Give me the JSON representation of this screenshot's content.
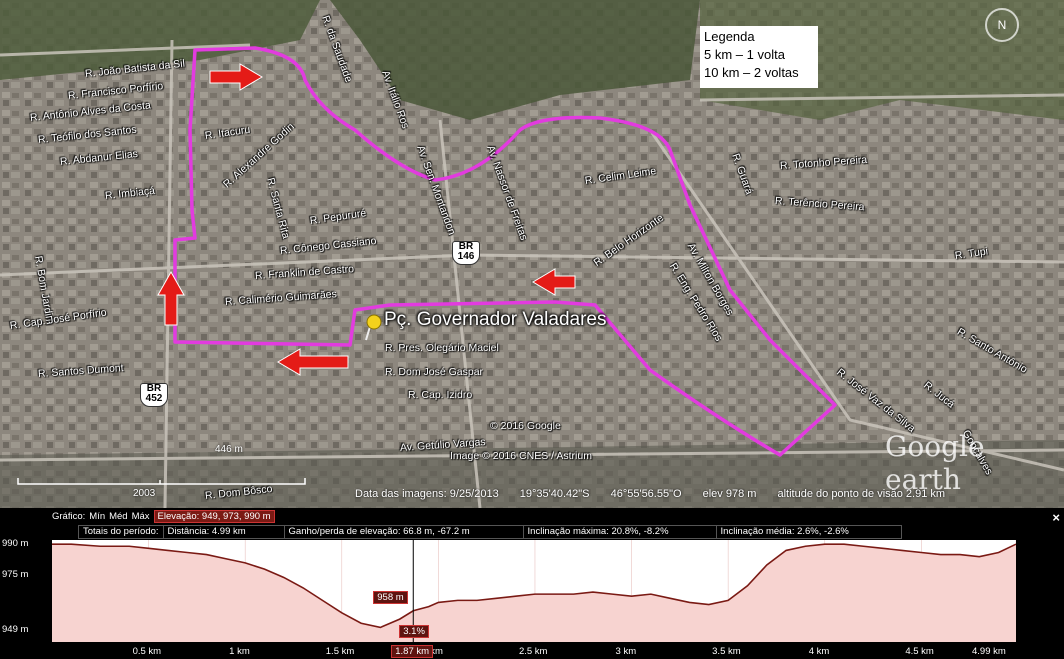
{
  "legend": {
    "title": "Legenda",
    "line1": "5 km – 1 volta",
    "line2": "10 km – 2 voltas"
  },
  "plaza": "Pç. Governador Valadares",
  "streets": [
    {
      "t": "R. João Batista da Sil",
      "x": 85,
      "y": 68,
      "r": -6
    },
    {
      "t": "R. Francisco Porfírio",
      "x": 68,
      "y": 90,
      "r": -6
    },
    {
      "t": "R. Antônio Alves da Costa",
      "x": 30,
      "y": 112,
      "r": -6
    },
    {
      "t": "R. Teófilo dos Santos",
      "x": 38,
      "y": 134,
      "r": -6
    },
    {
      "t": "R. Abdanur Elias",
      "x": 60,
      "y": 156,
      "r": -6
    },
    {
      "t": "R. Imbiaçá",
      "x": 105,
      "y": 190,
      "r": -6
    },
    {
      "t": "R. Bom Jardim",
      "x": 38,
      "y": 250,
      "r": 80
    },
    {
      "t": "R. Itacuru",
      "x": 205,
      "y": 130,
      "r": -8
    },
    {
      "t": "R. Alexandre Godin",
      "x": 225,
      "y": 180,
      "r": -42
    },
    {
      "t": "R. Santa Rita",
      "x": 270,
      "y": 172,
      "r": 75
    },
    {
      "t": "R. da Saudade",
      "x": 325,
      "y": 10,
      "r": 70
    },
    {
      "t": "Av. Itálio Ros",
      "x": 385,
      "y": 65,
      "r": 70
    },
    {
      "t": "Av. Sen. Montandon",
      "x": 420,
      "y": 140,
      "r": 70
    },
    {
      "t": "Av. Nassor de Freitas",
      "x": 490,
      "y": 140,
      "r": 70
    },
    {
      "t": "R. Pepururé",
      "x": 310,
      "y": 215,
      "r": -8
    },
    {
      "t": "R. Cônego Cassiano",
      "x": 280,
      "y": 245,
      "r": -6
    },
    {
      "t": "R. Franklin de Castro",
      "x": 255,
      "y": 270,
      "r": -4
    },
    {
      "t": "R. Calimério Guimarães",
      "x": 225,
      "y": 296,
      "r": -4
    },
    {
      "t": "R. Cap. José Porfírio",
      "x": 10,
      "y": 320,
      "r": -8
    },
    {
      "t": "R. Santos Dumont",
      "x": 38,
      "y": 368,
      "r": -4
    },
    {
      "t": "R. Pres. Olegário Maciel",
      "x": 385,
      "y": 342,
      "r": 0
    },
    {
      "t": "R. Dom José Gaspar",
      "x": 385,
      "y": 366,
      "r": 0
    },
    {
      "t": "R. Cap. Izidro",
      "x": 408,
      "y": 389,
      "r": 0
    },
    {
      "t": "Av. Getúlio Vargas",
      "x": 400,
      "y": 442,
      "r": -4
    },
    {
      "t": "R. Dom Bôsco",
      "x": 205,
      "y": 490,
      "r": -6
    },
    {
      "t": "R. Celim Leime",
      "x": 585,
      "y": 175,
      "r": -8
    },
    {
      "t": "R. Belo Horizonte",
      "x": 595,
      "y": 258,
      "r": -35
    },
    {
      "t": "Av. Milton Borges",
      "x": 690,
      "y": 238,
      "r": 60
    },
    {
      "t": "R. Eng. Pedro Rios",
      "x": 672,
      "y": 258,
      "r": 58
    },
    {
      "t": "R. Guará",
      "x": 735,
      "y": 148,
      "r": 70
    },
    {
      "t": "R. Totonho Pereira",
      "x": 780,
      "y": 160,
      "r": -4
    },
    {
      "t": "R. Terêncio Pereira",
      "x": 775,
      "y": 195,
      "r": 4
    },
    {
      "t": "R. Tupi",
      "x": 955,
      "y": 250,
      "r": -8
    },
    {
      "t": "R. Santo Antônio",
      "x": 958,
      "y": 325,
      "r": 30
    },
    {
      "t": "R. José Vaz da Silva",
      "x": 838,
      "y": 365,
      "r": 38
    },
    {
      "t": "R. Jucá",
      "x": 925,
      "y": 378,
      "r": 38
    },
    {
      "t": "Gonçalves",
      "x": 965,
      "y": 425,
      "r": 60
    }
  ],
  "shields": [
    {
      "top": "BR",
      "num": "146"
    },
    {
      "top": "BR",
      "num": "452"
    }
  ],
  "copyright1": "© 2016 Google",
  "copyright2": "Image © 2016 CNES / Astrium",
  "scale_label": "446 m",
  "year": "2003",
  "branding": "Google earth",
  "compass": "N",
  "status": {
    "date": "Data das imagens: 9/25/2013",
    "lat": "19°35'40.42\"S",
    "lon": "46°55'56.55\"O",
    "elev": "elev  978 m",
    "alt": "altitude do ponto de visão  2.91 km"
  },
  "panel": {
    "graph_label": "Gráfico:",
    "min": "Mín",
    "med": "Méd",
    "max": "Máx",
    "elevation": "Elevação: 949, 973, 990 m",
    "totals": "Totais do período:",
    "distance": "Distância: 4.99 km",
    "gain": "Ganho/perda de elevação: 66.8 m, -67.2 m",
    "max_slope": "Inclinação máxima: 20.8%, -8.2%",
    "avg_slope": "Inclinação média: 2.6%, -2.6%",
    "close": "×",
    "cursor_elev": "958 m",
    "cursor_slope": "3.1%",
    "cursor_dist": "1.87 km"
  },
  "chart_data": {
    "type": "area",
    "title": "",
    "xlabel": "",
    "ylabel": "",
    "xlim": [
      0,
      4.99
    ],
    "ylim": [
      943,
      992
    ],
    "y_ticks": [
      "990 m",
      "975 m",
      "949 m"
    ],
    "y_tick_values": [
      990,
      975,
      949
    ],
    "x_ticks": [
      "0.5 km",
      "1 km",
      "1.5 km",
      "2 km",
      "2.5 km",
      "3 km",
      "3.5 km",
      "4 km",
      "4.5 km",
      "4.99 km"
    ],
    "x_tick_values": [
      0.5,
      1,
      1.5,
      2,
      2.5,
      3,
      3.5,
      4,
      4.5,
      4.99
    ],
    "x": [
      0,
      0.1,
      0.25,
      0.4,
      0.5,
      0.6,
      0.7,
      0.8,
      0.9,
      1.0,
      1.1,
      1.2,
      1.3,
      1.4,
      1.5,
      1.6,
      1.7,
      1.8,
      1.87,
      1.95,
      2.0,
      2.1,
      2.2,
      2.3,
      2.4,
      2.5,
      2.6,
      2.7,
      2.8,
      2.9,
      3.0,
      3.1,
      3.2,
      3.3,
      3.4,
      3.5,
      3.6,
      3.7,
      3.8,
      3.9,
      4.0,
      4.1,
      4.2,
      4.3,
      4.4,
      4.5,
      4.6,
      4.7,
      4.8,
      4.9,
      4.99
    ],
    "y": [
      990,
      990,
      989,
      989,
      988,
      987,
      986,
      985,
      983,
      981,
      978,
      974,
      969,
      963,
      957,
      952,
      950,
      954,
      958,
      960,
      962,
      963,
      963,
      964,
      965,
      966,
      966,
      966,
      967,
      966,
      965,
      966,
      964,
      962,
      961,
      963,
      970,
      980,
      987,
      989,
      990,
      990,
      989,
      988,
      987,
      986,
      985,
      985,
      984,
      986,
      990
    ],
    "cursor_x": 1.87,
    "colors": {
      "fill": "#f7d3d0",
      "line": "#7a1a14",
      "cursor": "#ffffff"
    }
  }
}
